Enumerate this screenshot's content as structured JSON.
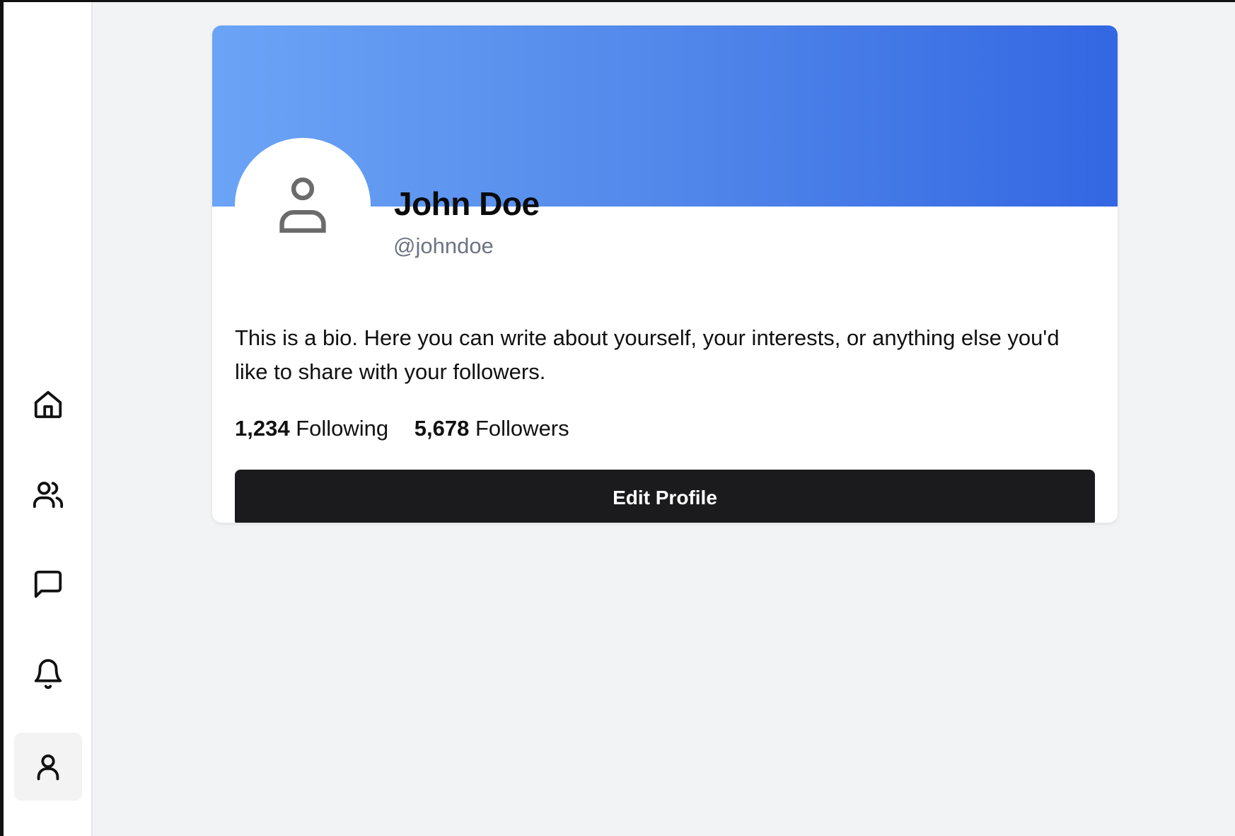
{
  "sidebar": {
    "items": [
      {
        "id": "home",
        "icon": "home-icon",
        "active": false
      },
      {
        "id": "friends",
        "icon": "users-icon",
        "active": false
      },
      {
        "id": "messages",
        "icon": "message-square-icon",
        "active": false
      },
      {
        "id": "notifications",
        "icon": "bell-icon",
        "active": false
      },
      {
        "id": "profile",
        "icon": "user-icon",
        "active": true
      }
    ]
  },
  "profile": {
    "avatar_icon": "user-icon",
    "name": "John Doe",
    "handle": "@johndoe",
    "bio": "This is a bio. Here you can write about yourself, your interests, or anything else you'd like to share with your followers.",
    "following_count": "1,234",
    "following_label": "Following",
    "followers_count": "5,678",
    "followers_label": "Followers",
    "edit_button_label": "Edit Profile"
  },
  "colors": {
    "banner_start": "#6ba4f6",
    "banner_end": "#3367e3",
    "button_bg": "#1b1b1d",
    "page_bg": "#f2f3f5",
    "handle_text": "#6d7481"
  }
}
